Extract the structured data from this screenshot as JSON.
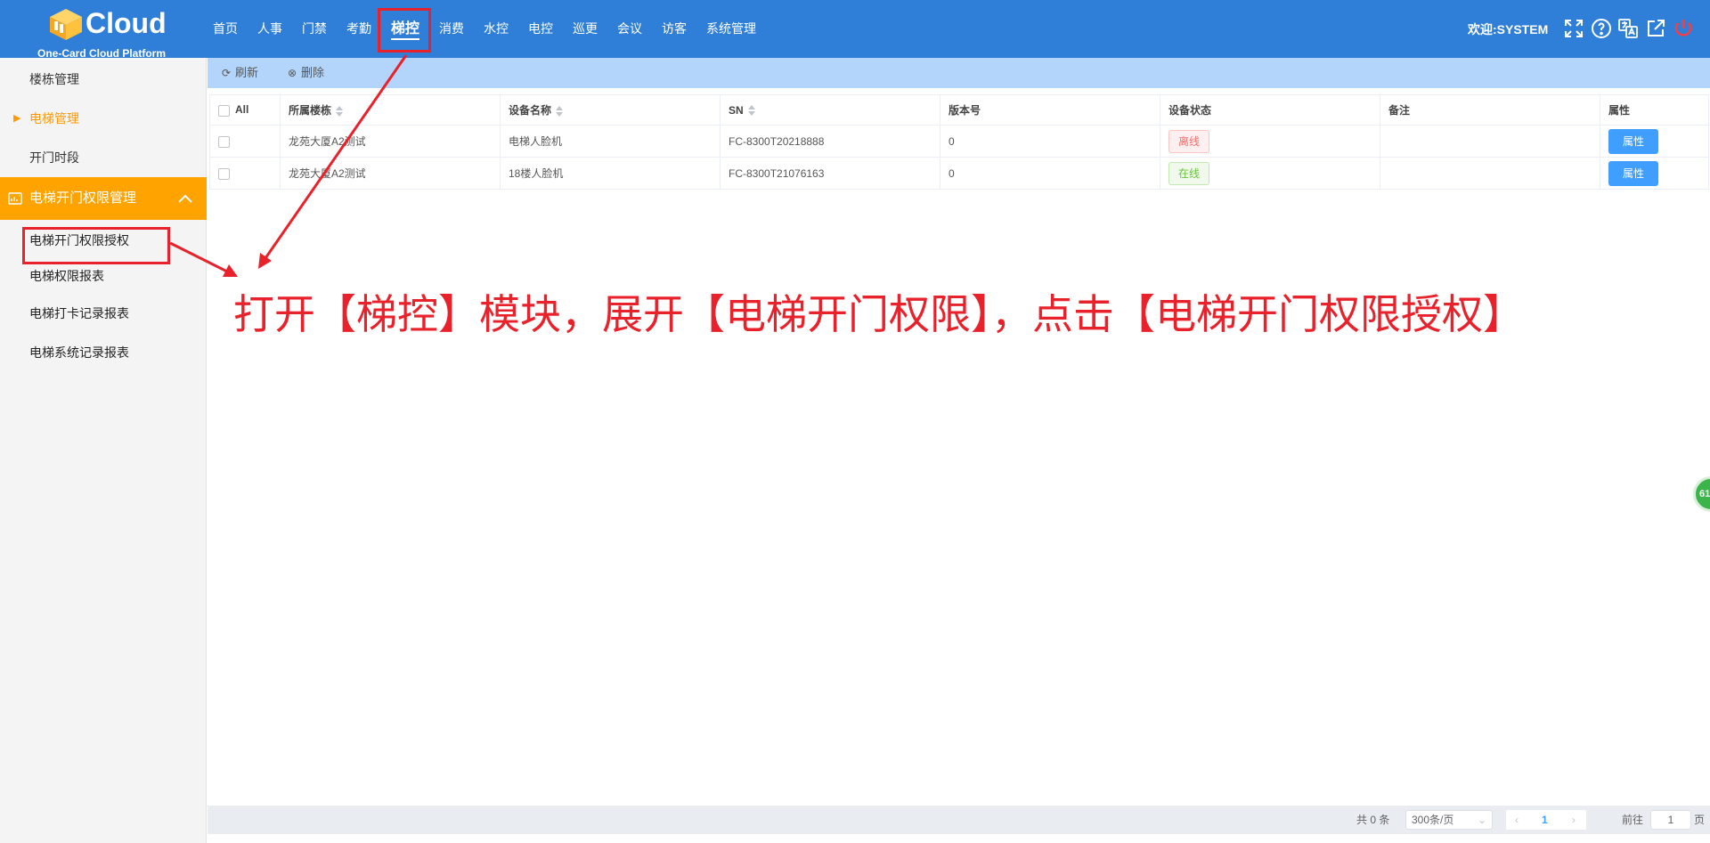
{
  "header": {
    "brand": "Cloud",
    "brand_subtitle": "One-Card Cloud Platform",
    "nav": [
      "首页",
      "人事",
      "门禁",
      "考勤",
      "梯控",
      "消费",
      "水控",
      "电控",
      "巡更",
      "会议",
      "访客",
      "系统管理"
    ],
    "active_nav": "梯控",
    "welcome": "欢迎:SYSTEM",
    "icons": [
      "fullscreen-icon",
      "help-icon",
      "language-icon",
      "external-link-icon",
      "power-icon"
    ]
  },
  "sidebar": {
    "items": [
      "楼栋管理",
      "电梯管理",
      "开门时段"
    ],
    "current_item": "电梯管理",
    "group": "电梯开门权限管理",
    "sub_items": [
      "电梯开门权限授权",
      "电梯权限报表",
      "电梯打卡记录报表",
      "电梯系统记录报表"
    ]
  },
  "toolbar": {
    "refresh_label": "刷新",
    "delete_label": "删除"
  },
  "table": {
    "select_all": "All",
    "headers": [
      "所属楼栋",
      "设备名称",
      "SN",
      "版本号",
      "设备状态",
      "备注",
      "属性"
    ],
    "rows": [
      {
        "building": "龙苑大厦A2测试",
        "device": "电梯人脸机",
        "sn": "FC-8300T20218888",
        "version": "0",
        "status": "离线",
        "remark": "",
        "action": "属性"
      },
      {
        "building": "龙苑大厦A2测试",
        "device": "18楼人脸机",
        "sn": "FC-8300T21076163",
        "version": "0",
        "status": "在线",
        "remark": "",
        "action": "属性"
      }
    ]
  },
  "pagination": {
    "total": "共 0 条",
    "page_size": "300条/页",
    "current_page": "1",
    "goto_label": "前往",
    "goto_value": "1",
    "page_suffix": "页"
  },
  "annotation": {
    "text": "打开【梯控】模块，展开【电梯开门权限】，点击【电梯开门权限授权】",
    "color": "#e8212b"
  },
  "float_badge": "61",
  "colors": {
    "header_bg": "#2f7fd8",
    "sidebar_active_bg": "#ffa300",
    "toolbar_bg": "#b3d5fb",
    "primary_button": "#409eff"
  }
}
